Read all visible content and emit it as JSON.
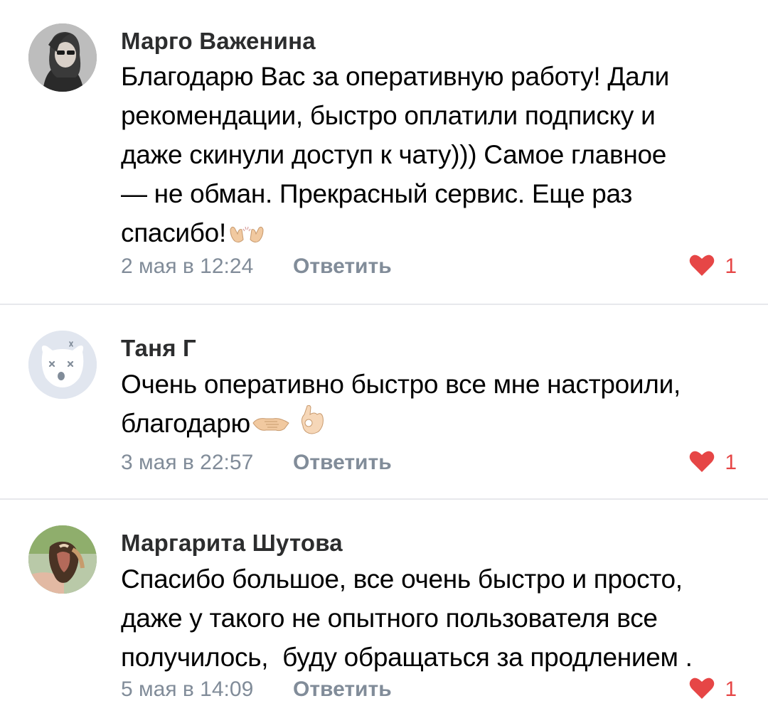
{
  "comments": [
    {
      "author": "Марго Важенина",
      "lines": [
        "Благодарю Вас за оперативную работу! Дали",
        "рекомендации, быстро оплатили подписку и",
        "даже скинули доступ к чату))) Самое главное",
        "— не обман. Прекрасный сервис. Еще раз",
        "спасибо!"
      ],
      "emoji": [
        "raising-hands-icon"
      ],
      "date": "2 мая в 12:24",
      "reply_label": "Ответить",
      "likes": "1"
    },
    {
      "author": "Таня Г",
      "lines": [
        "Очень оперативно быстро все мне настроили,",
        "благодарю"
      ],
      "emoji": [
        "handshake-icon",
        "ok-hand-icon"
      ],
      "date": "3 мая в 22:57",
      "reply_label": "Ответить",
      "likes": "1"
    },
    {
      "author": "Маргарита Шутова",
      "lines": [
        "Спасибо большое, все очень быстро и просто,",
        "даже у такого не опытного пользователя все",
        "получилось,  буду обращаться за продлением ."
      ],
      "emoji": [],
      "date": "5 мая в 14:09",
      "reply_label": "Ответить",
      "likes": "1"
    }
  ],
  "colors": {
    "like": "#e64646",
    "meta": "#818c99",
    "divider": "#e7e8ec",
    "avatar_placeholder": "#e1e6ef"
  }
}
